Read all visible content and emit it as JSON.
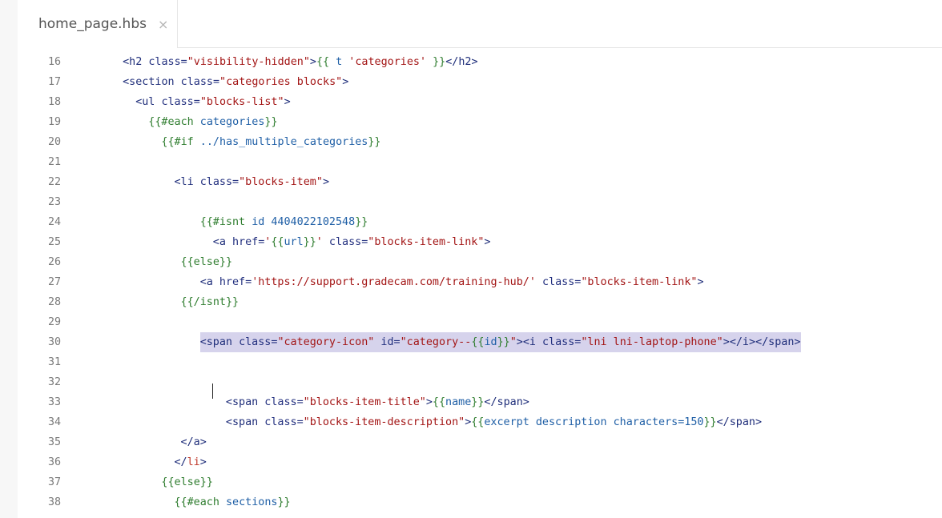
{
  "tab": {
    "filename": "home_page.hbs",
    "close_glyph": "×"
  },
  "editor": {
    "lines": [
      {
        "n": "16",
        "segs": [
          [
            "tag",
            "<h2 "
          ],
          [
            "attr",
            "class="
          ],
          [
            "str",
            "\"visibility-hidden\""
          ],
          [
            "tag",
            ">"
          ],
          [
            "mus",
            "{{ "
          ],
          [
            "var",
            "t "
          ],
          [
            "str",
            "'categories'"
          ],
          [
            "mus",
            " }}"
          ],
          [
            "tag",
            "</h2>"
          ]
        ],
        "indent": 1
      },
      {
        "n": "17",
        "segs": [
          [
            "tag",
            "<section "
          ],
          [
            "attr",
            "class="
          ],
          [
            "str",
            "\"categories blocks\""
          ],
          [
            "tag",
            ">"
          ]
        ],
        "indent": 1
      },
      {
        "n": "18",
        "segs": [
          [
            "tag",
            "<ul "
          ],
          [
            "attr",
            "class="
          ],
          [
            "str",
            "\"blocks-list\""
          ],
          [
            "tag",
            ">"
          ]
        ],
        "indent": 2
      },
      {
        "n": "19",
        "segs": [
          [
            "mus",
            "{{#each "
          ],
          [
            "var",
            "categories"
          ],
          [
            "mus",
            "}}"
          ]
        ],
        "indent": 3
      },
      {
        "n": "20",
        "segs": [
          [
            "mus",
            "{{#if "
          ],
          [
            "var",
            "../has_multiple_categories"
          ],
          [
            "mus",
            "}}"
          ]
        ],
        "indent": 4
      },
      {
        "n": "21",
        "segs": [],
        "indent": 0
      },
      {
        "n": "22",
        "segs": [
          [
            "tag",
            "<li "
          ],
          [
            "attr",
            "class="
          ],
          [
            "str",
            "\"blocks-item\""
          ],
          [
            "tag",
            ">"
          ]
        ],
        "indent": 5
      },
      {
        "n": "23",
        "segs": [],
        "indent": 0
      },
      {
        "n": "24",
        "segs": [
          [
            "mus",
            "{{#isnt "
          ],
          [
            "var",
            "id 4404022102548"
          ],
          [
            "mus",
            "}}"
          ]
        ],
        "indent": 6,
        "extra": 2
      },
      {
        "n": "25",
        "segs": [
          [
            "tag",
            "<a "
          ],
          [
            "attr",
            "href="
          ],
          [
            "str",
            "'"
          ],
          [
            "mus",
            "{{"
          ],
          [
            "var",
            "url"
          ],
          [
            "mus",
            "}}"
          ],
          [
            "str",
            "'"
          ],
          [
            "attr",
            " class="
          ],
          [
            "str",
            "\"blocks-item-link\""
          ],
          [
            "tag",
            ">"
          ]
        ],
        "indent": 7,
        "extra": 2
      },
      {
        "n": "26",
        "segs": [
          [
            "mus",
            "{{else}}"
          ]
        ],
        "indent": 6,
        "extra": -1
      },
      {
        "n": "27",
        "segs": [
          [
            "tag",
            "<a "
          ],
          [
            "attr",
            "href="
          ],
          [
            "str",
            "'https://support.gradecam.com/training-hub/'"
          ],
          [
            "attr",
            " class="
          ],
          [
            "str",
            "\"blocks-item-link\""
          ],
          [
            "tag",
            ">"
          ]
        ],
        "indent": 7
      },
      {
        "n": "28",
        "segs": [
          [
            "mus",
            "{{/isnt}}"
          ]
        ],
        "indent": 6,
        "extra": -1
      },
      {
        "n": "29",
        "segs": [],
        "indent": 0
      },
      {
        "n": "30",
        "segs": [
          [
            "tag",
            "<span "
          ],
          [
            "attr",
            "class="
          ],
          [
            "str",
            "\"category-icon\""
          ],
          [
            "attr",
            " id="
          ],
          [
            "str",
            "\"category--"
          ],
          [
            "mus",
            "{{"
          ],
          [
            "var",
            "id"
          ],
          [
            "mus",
            "}}"
          ],
          [
            "str",
            "\""
          ],
          [
            "tag",
            ">"
          ],
          [
            "tag",
            "<i "
          ],
          [
            "attr",
            "class="
          ],
          [
            "str",
            "\"lni lni-laptop-phone\""
          ],
          [
            "tag",
            ">"
          ],
          [
            "tag",
            "</i>"
          ],
          [
            "tag",
            "</span>"
          ]
        ],
        "indent": 7,
        "extra": 0,
        "highlight": true
      },
      {
        "n": "31",
        "segs": [],
        "indent": 0
      },
      {
        "n": "32",
        "segs": [],
        "indent": 0
      },
      {
        "n": "33",
        "segs": [
          [
            "tag",
            "<span "
          ],
          [
            "attr",
            "class="
          ],
          [
            "str",
            "\"blocks-item-title\""
          ],
          [
            "tag",
            ">"
          ],
          [
            "mus",
            "{{"
          ],
          [
            "var",
            "name"
          ],
          [
            "mus",
            "}}"
          ],
          [
            "tag",
            "</span>"
          ]
        ],
        "indent": 6,
        "extra": 6
      },
      {
        "n": "34",
        "segs": [
          [
            "tag",
            "<span "
          ],
          [
            "attr",
            "class="
          ],
          [
            "str",
            "\"blocks-item-description\""
          ],
          [
            "tag",
            ">"
          ],
          [
            "mus",
            "{{"
          ],
          [
            "var",
            "excerpt description characters=150"
          ],
          [
            "mus",
            "}}"
          ],
          [
            "tag",
            "</span>"
          ]
        ],
        "indent": 6,
        "extra": 6
      },
      {
        "n": "35",
        "segs": [
          [
            "tag",
            "</a>"
          ]
        ],
        "indent": 6,
        "extra": -1
      },
      {
        "n": "36",
        "segs": [
          [
            "tag",
            "</"
          ],
          [
            "red",
            "li"
          ],
          [
            "tag",
            ">"
          ]
        ],
        "indent": 5
      },
      {
        "n": "37",
        "segs": [
          [
            "mus",
            "{{else}}"
          ]
        ],
        "indent": 4
      },
      {
        "n": "38",
        "segs": [
          [
            "mus",
            "{{#each "
          ],
          [
            "var",
            "sections"
          ],
          [
            "mus",
            "}}"
          ]
        ],
        "indent": 4,
        "extra": 2
      }
    ]
  },
  "colors": {
    "tag": "#1f2e7a",
    "attr": "#23307f",
    "str": "#a31515",
    "mustache": "#2f7d2f",
    "variable": "#1f5fa6",
    "highlight": "#d6d3ec"
  }
}
